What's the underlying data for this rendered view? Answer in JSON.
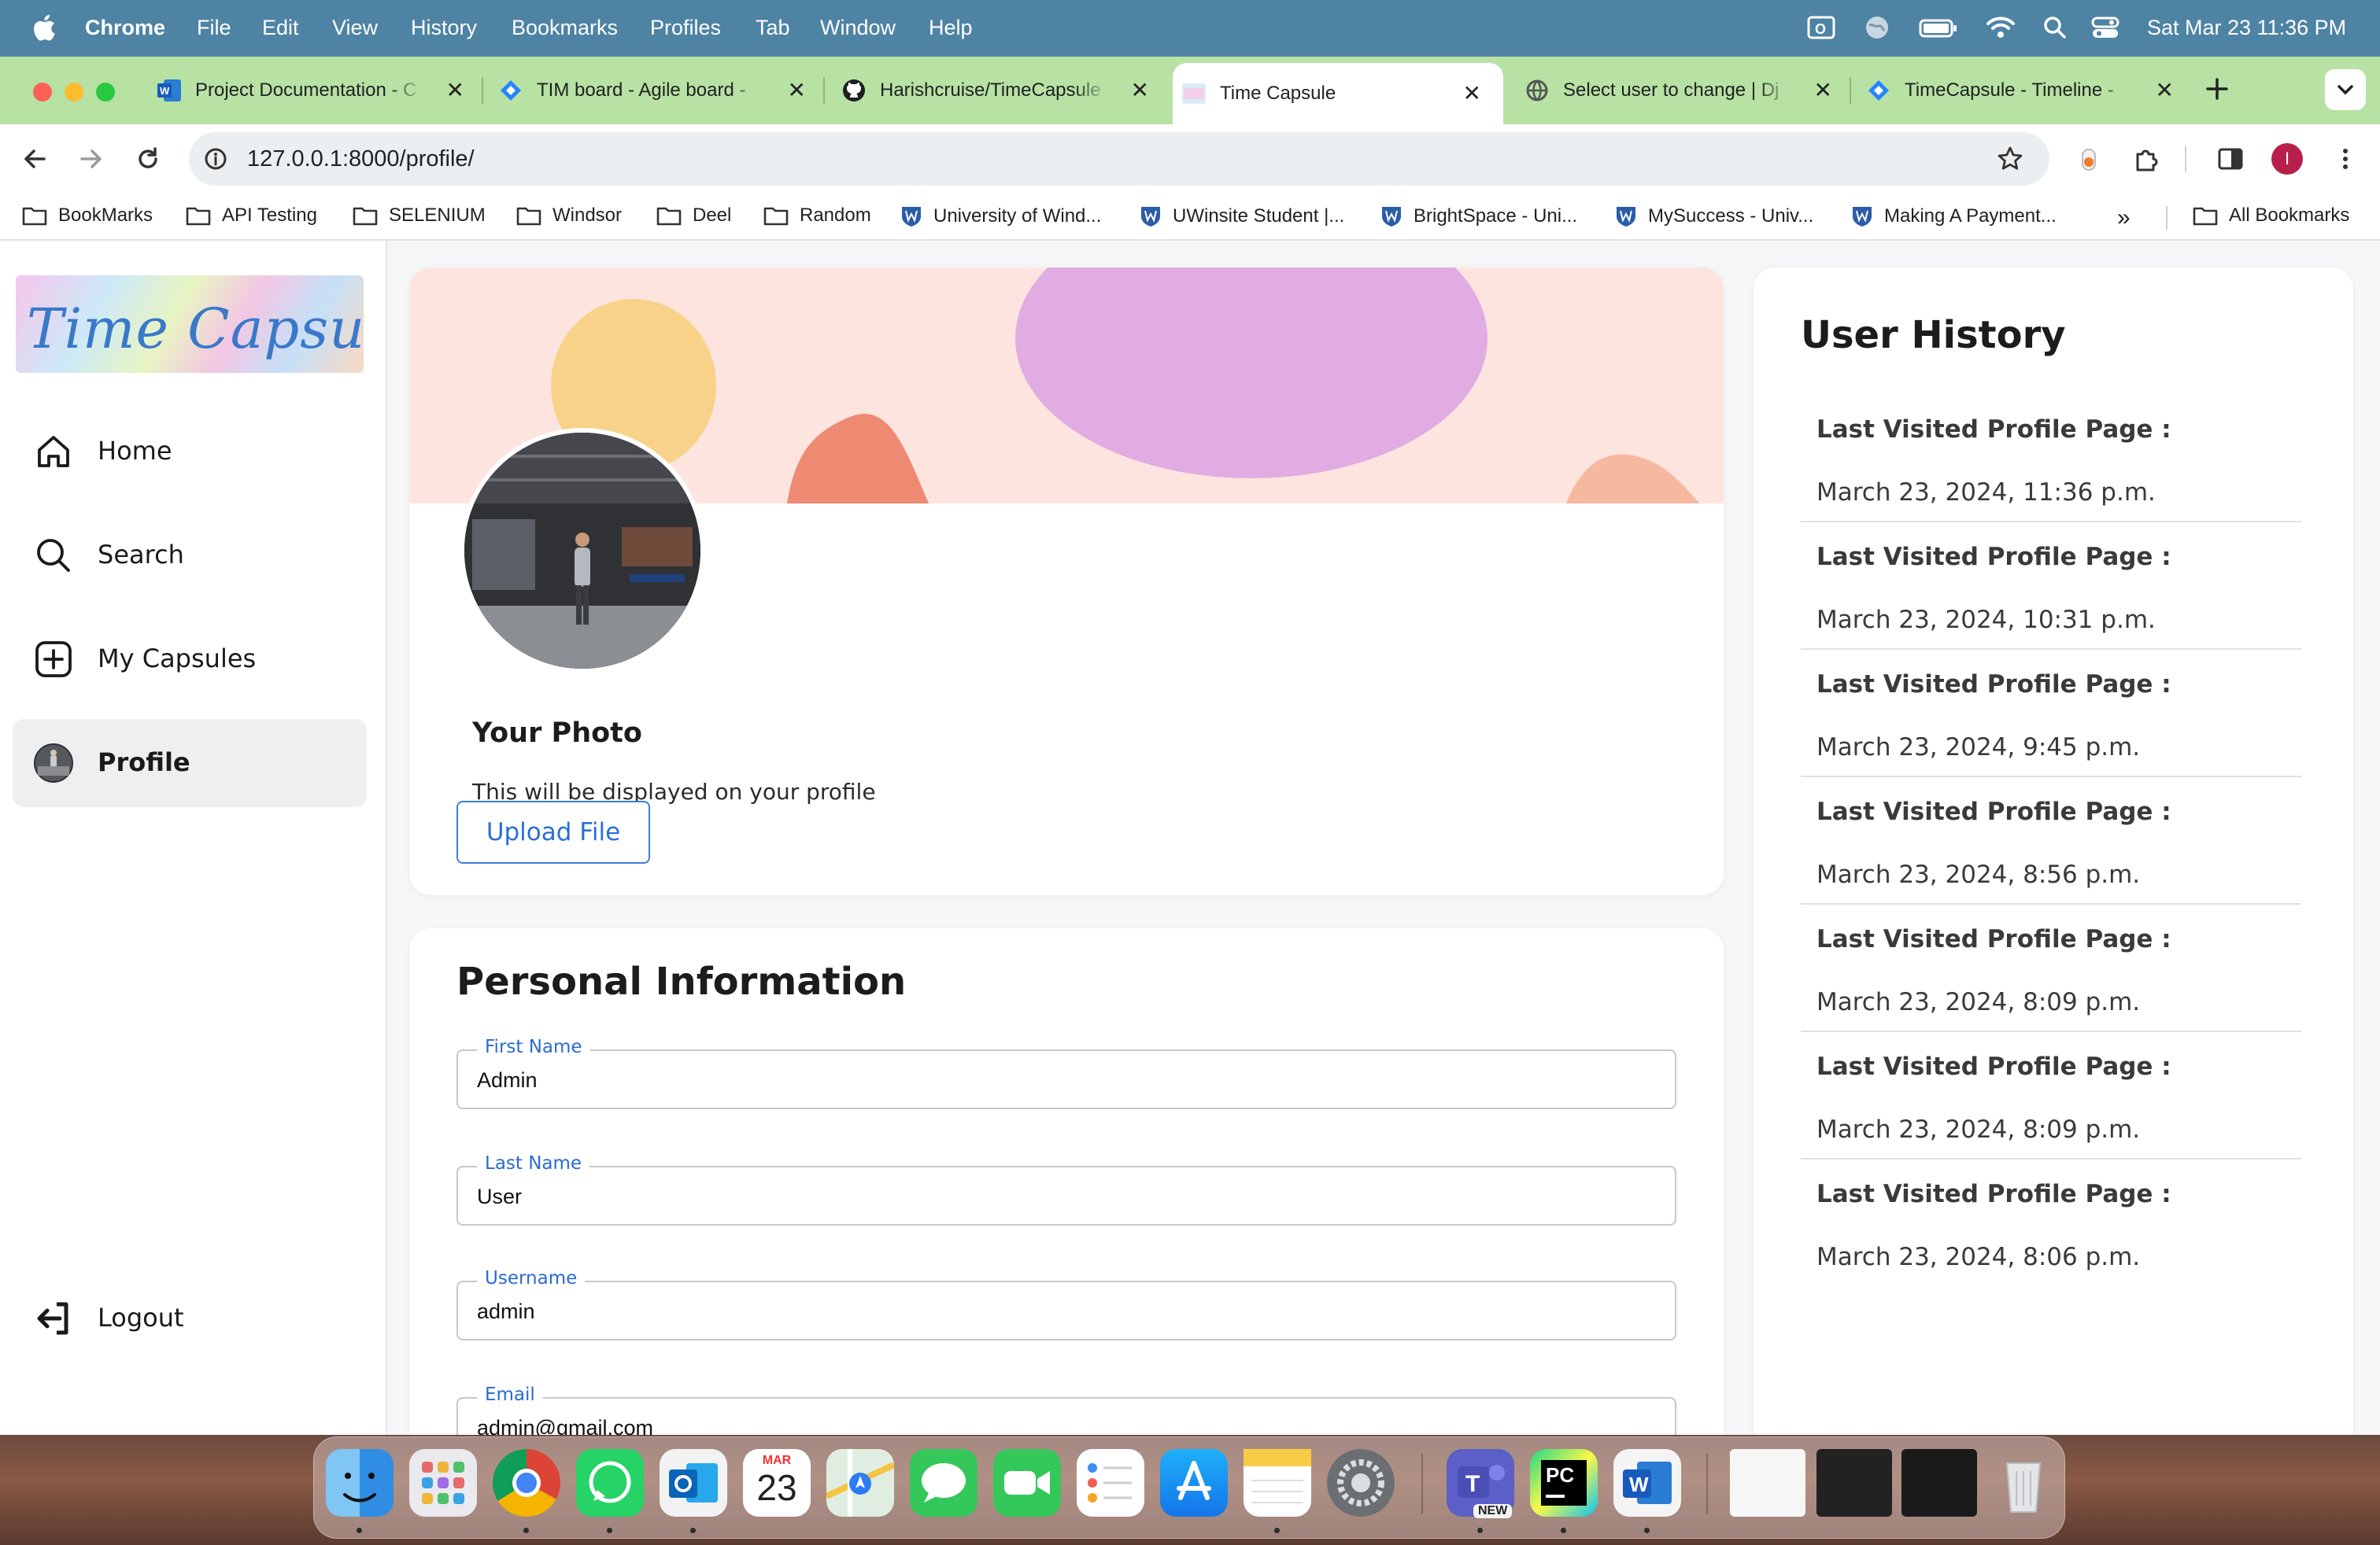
{
  "menubar": {
    "app": "Chrome",
    "items": [
      "File",
      "Edit",
      "View",
      "History",
      "Bookmarks",
      "Profiles",
      "Tab",
      "Window",
      "Help"
    ],
    "clock": "Sat Mar 23  11:36 PM"
  },
  "tabs": [
    {
      "title": "Project Documentation - C",
      "icon": "word-icon"
    },
    {
      "title": "TIM board - Agile board -",
      "icon": "jira-icon"
    },
    {
      "title": "Harishcruise/TimeCapsule",
      "icon": "github-icon"
    },
    {
      "title": "Time Capsule",
      "icon": "time-capsule-favicon",
      "active": true
    },
    {
      "title": "Select user to change | Dj",
      "icon": "globe-icon"
    },
    {
      "title": "TimeCapsule - Timeline -",
      "icon": "jira-icon"
    }
  ],
  "address_bar": {
    "url": "127.0.0.1:8000/profile/"
  },
  "bookmarks": [
    {
      "label": "BookMarks",
      "icon": "folder-icon"
    },
    {
      "label": "API Testing",
      "icon": "folder-icon"
    },
    {
      "label": "SELENIUM",
      "icon": "folder-icon"
    },
    {
      "label": "Windsor",
      "icon": "folder-icon"
    },
    {
      "label": "Deel",
      "icon": "folder-icon"
    },
    {
      "label": "Random",
      "icon": "folder-icon"
    },
    {
      "label": "University of Wind...",
      "icon": "uwindsor-shield-icon"
    },
    {
      "label": "UWinsite Student |...",
      "icon": "uwindsor-shield-icon"
    },
    {
      "label": "BrightSpace - Uni...",
      "icon": "uwindsor-shield-icon"
    },
    {
      "label": "MySuccess - Univ...",
      "icon": "uwindsor-shield-icon"
    },
    {
      "label": "Making A Payment...",
      "icon": "uwindsor-shield-icon"
    }
  ],
  "bookmarks_overflow": "»",
  "all_bookmarks": "All Bookmarks",
  "sidebar": {
    "logo_text": "Time Capsule",
    "items": [
      {
        "label": "Home",
        "icon": "home-icon"
      },
      {
        "label": "Search",
        "icon": "search-icon"
      },
      {
        "label": "My Capsules",
        "icon": "plus-square-icon"
      },
      {
        "label": "Profile",
        "icon": "avatar-icon",
        "selected": true
      }
    ],
    "logout": "Logout"
  },
  "photo_card": {
    "heading": "Your Photo",
    "description": "This will be displayed on your profile",
    "upload_label": "Upload File"
  },
  "personal_info": {
    "heading": "Personal Information",
    "fields": [
      {
        "label": "First Name",
        "value": "Admin"
      },
      {
        "label": "Last Name",
        "value": "User"
      },
      {
        "label": "Username",
        "value": "admin"
      },
      {
        "label": "Email",
        "value": "admin@gmail.com"
      }
    ]
  },
  "history": {
    "heading": "User History",
    "entries": [
      {
        "label": "Last Visited Profile Page :",
        "value": "March 23, 2024, 11:36 p.m."
      },
      {
        "label": "Last Visited Profile Page :",
        "value": "March 23, 2024, 10:31 p.m."
      },
      {
        "label": "Last Visited Profile Page :",
        "value": "March 23, 2024, 9:45 p.m."
      },
      {
        "label": "Last Visited Profile Page :",
        "value": "March 23, 2024, 8:56 p.m."
      },
      {
        "label": "Last Visited Profile Page :",
        "value": "March 23, 2024, 8:09 p.m."
      },
      {
        "label": "Last Visited Profile Page :",
        "value": "March 23, 2024, 8:09 p.m."
      },
      {
        "label": "Last Visited Profile Page :",
        "value": "March 23, 2024, 8:06 p.m."
      }
    ]
  },
  "dock": {
    "calendar_month": "MAR",
    "calendar_day": "23",
    "teams_badge": "NEW",
    "pycharm_label": "PC",
    "word_label": "W"
  },
  "colors": {
    "menubar": "#4e83a4",
    "tabstrip": "#b7e2a3",
    "accent": "#2b6fd6",
    "banner": "#fde4df"
  }
}
